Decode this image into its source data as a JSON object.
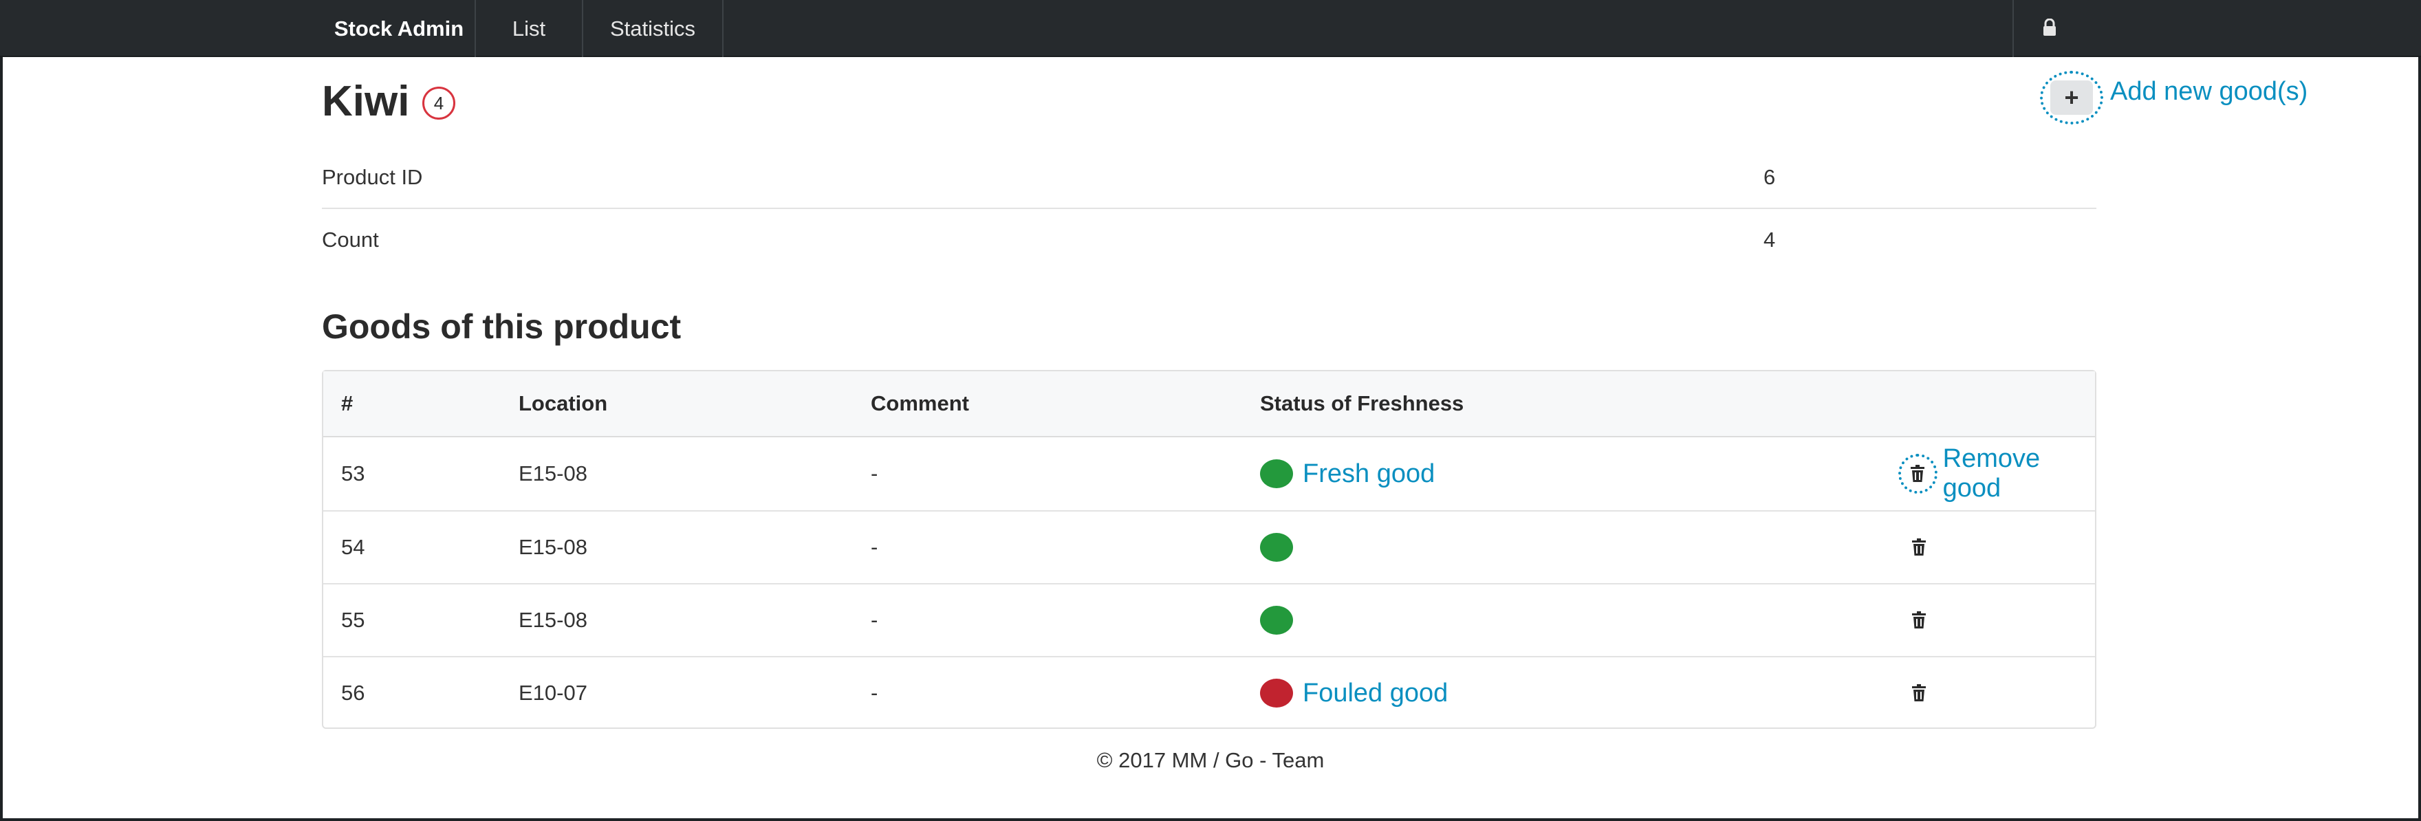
{
  "navbar": {
    "brand": "Stock Admin",
    "items": [
      {
        "label": "List"
      },
      {
        "label": "Statistics"
      }
    ],
    "lock_icon": "lock-icon"
  },
  "product": {
    "name": "Kiwi",
    "badge_count": "4",
    "add_button_icon": "plus-icon",
    "add_label": "Add new good(s)",
    "info": [
      {
        "label": "Product ID",
        "value": "6"
      },
      {
        "label": "Count",
        "value": "4"
      }
    ]
  },
  "goods": {
    "title": "Goods of this product",
    "columns": [
      "#",
      "Location",
      "Comment",
      "Status of Freshness"
    ],
    "rows": [
      {
        "id": "53",
        "location": "E15-08",
        "comment": "-",
        "status": "fresh",
        "status_label": "Fresh good",
        "delete_label": "Remove good"
      },
      {
        "id": "54",
        "location": "E15-08",
        "comment": "-",
        "status": "fresh",
        "status_label": "",
        "delete_label": ""
      },
      {
        "id": "55",
        "location": "E15-08",
        "comment": "-",
        "status": "fresh",
        "status_label": "",
        "delete_label": ""
      },
      {
        "id": "56",
        "location": "E10-07",
        "comment": "-",
        "status": "fouled",
        "status_label": "Fouled good",
        "delete_label": ""
      }
    ]
  },
  "colors": {
    "fresh": "#23993c",
    "fouled": "#c1232f",
    "annotation": "#0a8fc0",
    "navbar": "#262a2d"
  },
  "footer": {
    "text": "© 2017 MM / Go - Team"
  }
}
